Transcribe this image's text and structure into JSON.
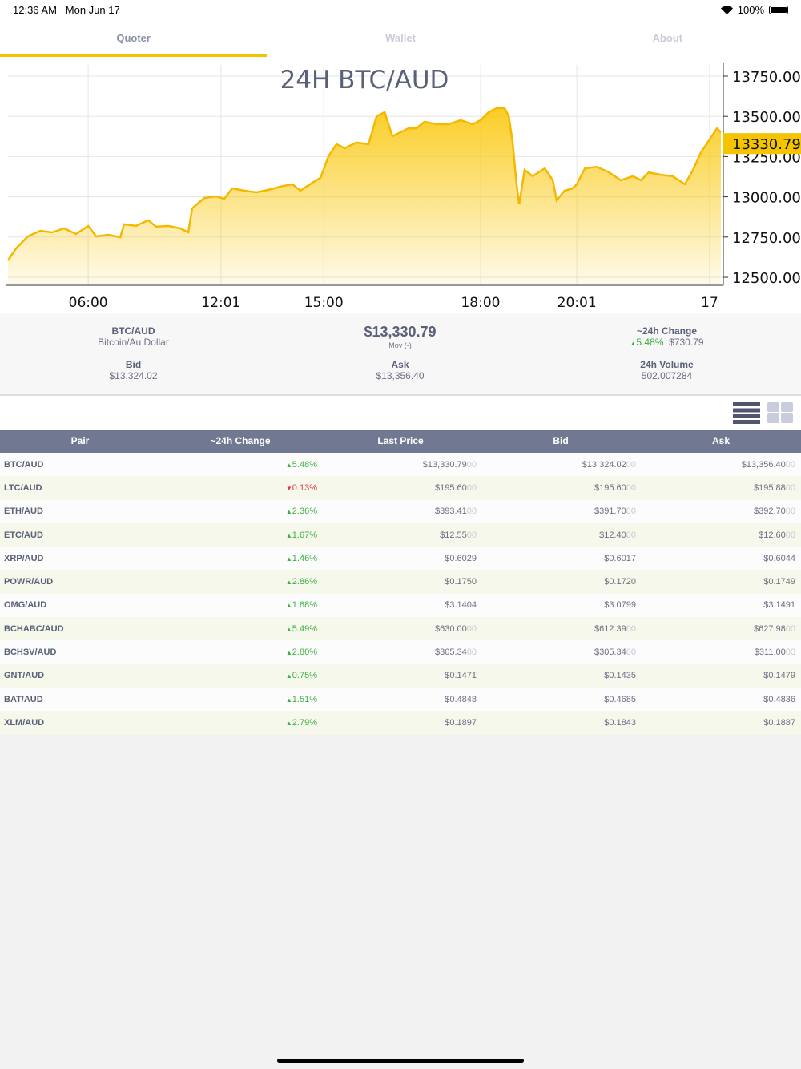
{
  "status": {
    "time": "12:36 AM",
    "date": "Mon Jun 17",
    "battery": "100%"
  },
  "tabs": [
    {
      "label": "Quoter",
      "active": true
    },
    {
      "label": "Wallet",
      "active": false
    },
    {
      "label": "About",
      "active": false
    }
  ],
  "chart_data": {
    "type": "area",
    "title": "24H BTC/AUD",
    "color": "#f5c400",
    "ylim": [
      12450,
      13800
    ],
    "yticks": [
      12500,
      12750,
      13000,
      13250,
      13500,
      13750
    ],
    "ytick_labels": [
      "12500.00",
      "12750.00",
      "13000.00",
      "13250.00",
      "13500.00",
      "13750.00"
    ],
    "xlim": [
      0,
      24
    ],
    "xticks": [
      {
        "x": 2.7,
        "label": "06:00"
      },
      {
        "x": 7.17,
        "label": "12:01"
      },
      {
        "x": 10.63,
        "label": "15:00"
      },
      {
        "x": 15.91,
        "label": "18:00"
      },
      {
        "x": 19.15,
        "label": "20:01"
      },
      {
        "x": 23.62,
        "label": "17"
      }
    ],
    "current": {
      "value": 13330.79,
      "label": "13330.79"
    },
    "x": [
      0,
      0.27,
      0.67,
      1.08,
      1.48,
      1.89,
      2.29,
      2.7,
      2.97,
      3.37,
      3.78,
      3.91,
      4.31,
      4.72,
      4.99,
      5.39,
      5.8,
      6.07,
      6.2,
      6.61,
      7.01,
      7.28,
      7.55,
      7.96,
      8.36,
      8.76,
      9.17,
      9.57,
      9.84,
      10.25,
      10.52,
      10.79,
      11.06,
      11.33,
      11.73,
      12.14,
      12.41,
      12.68,
      12.94,
      13.21,
      13.48,
      13.75,
      14.02,
      14.43,
      14.83,
      15.24,
      15.64,
      15.91,
      16.18,
      16.45,
      16.72,
      16.86,
      16.99,
      17.12,
      17.21,
      17.39,
      17.66,
      18.07,
      18.34,
      18.47,
      18.74,
      19.01,
      19.15,
      19.42,
      19.82,
      20.23,
      20.63,
      21.04,
      21.31,
      21.57,
      21.98,
      22.38,
      22.79,
      23.06,
      23.33,
      23.6,
      23.87,
      24
    ],
    "values": [
      12604,
      12679,
      12754,
      12789,
      12779,
      12804,
      12769,
      12819,
      12754,
      12764,
      12749,
      12829,
      12819,
      12854,
      12814,
      12819,
      12804,
      12779,
      12928,
      12993,
      13003,
      12988,
      13053,
      13038,
      13028,
      13043,
      13063,
      13078,
      13038,
      13088,
      13118,
      13252,
      13327,
      13302,
      13337,
      13327,
      13501,
      13526,
      13377,
      13401,
      13426,
      13426,
      13466,
      13451,
      13451,
      13476,
      13451,
      13476,
      13526,
      13551,
      13551,
      13501,
      13337,
      13078,
      12953,
      13167,
      13128,
      13177,
      13103,
      12978,
      13038,
      13053,
      13078,
      13177,
      13187,
      13152,
      13103,
      13128,
      13103,
      13152,
      13137,
      13128,
      13078,
      13167,
      13277,
      13351,
      13426,
      13401
    ]
  },
  "info": {
    "pair": "BTC/AUD",
    "pair_name": "Bitcoin/Au Dollar",
    "price": "$13,330.79",
    "mov": "Mov (-)",
    "change_label": "~24h Change",
    "change_pct": "5.48%",
    "change_abs": "$730.79",
    "bid_label": "Bid",
    "bid": "$13,324.02",
    "ask_label": "Ask",
    "ask": "$13,356.40",
    "volume_label": "24h Volume",
    "volume": "502.007284"
  },
  "table": {
    "headers": [
      "Pair",
      "~24h Change",
      "Last Price",
      "Bid",
      "Ask"
    ],
    "rows": [
      {
        "pair": "BTC/AUD",
        "change": "5.48%",
        "dir": "up",
        "last": "$13,330.79",
        "last_pad": "00",
        "bid": "$13,324.02",
        "bid_pad": "00",
        "ask": "$13,356.40",
        "ask_pad": "00"
      },
      {
        "pair": "LTC/AUD",
        "change": "0.13%",
        "dir": "down",
        "last": "$195.60",
        "last_pad": "00",
        "bid": "$195.60",
        "bid_pad": "00",
        "ask": "$195.88",
        "ask_pad": "00"
      },
      {
        "pair": "ETH/AUD",
        "change": "2.36%",
        "dir": "up",
        "last": "$393.41",
        "last_pad": "00",
        "bid": "$391.70",
        "bid_pad": "00",
        "ask": "$392.70",
        "ask_pad": "00"
      },
      {
        "pair": "ETC/AUD",
        "change": "1.67%",
        "dir": "up",
        "last": "$12.55",
        "last_pad": "00",
        "bid": "$12.40",
        "bid_pad": "00",
        "ask": "$12.60",
        "ask_pad": "00"
      },
      {
        "pair": "XRP/AUD",
        "change": "1.46%",
        "dir": "up",
        "last": "$0.6029",
        "last_pad": "",
        "bid": "$0.6017",
        "bid_pad": "",
        "ask": "$0.6044",
        "ask_pad": ""
      },
      {
        "pair": "POWR/AUD",
        "change": "2.86%",
        "dir": "up",
        "last": "$0.1750",
        "last_pad": "",
        "bid": "$0.1720",
        "bid_pad": "",
        "ask": "$0.1749",
        "ask_pad": ""
      },
      {
        "pair": "OMG/AUD",
        "change": "1.88%",
        "dir": "up",
        "last": "$3.1404",
        "last_pad": "",
        "bid": "$3.0799",
        "bid_pad": "",
        "ask": "$3.1491",
        "ask_pad": ""
      },
      {
        "pair": "BCHABC/AUD",
        "change": "5.49%",
        "dir": "up",
        "last": "$630.00",
        "last_pad": "00",
        "bid": "$612.39",
        "bid_pad": "00",
        "ask": "$627.98",
        "ask_pad": "00"
      },
      {
        "pair": "BCHSV/AUD",
        "change": "2.80%",
        "dir": "up",
        "last": "$305.34",
        "last_pad": "00",
        "bid": "$305.34",
        "bid_pad": "00",
        "ask": "$311.00",
        "ask_pad": "00"
      },
      {
        "pair": "GNT/AUD",
        "change": "0.75%",
        "dir": "up",
        "last": "$0.1471",
        "last_pad": "",
        "bid": "$0.1435",
        "bid_pad": "",
        "ask": "$0.1479",
        "ask_pad": ""
      },
      {
        "pair": "BAT/AUD",
        "change": "1.51%",
        "dir": "up",
        "last": "$0.4848",
        "last_pad": "",
        "bid": "$0.4685",
        "bid_pad": "",
        "ask": "$0.4836",
        "ask_pad": ""
      },
      {
        "pair": "XLM/AUD",
        "change": "2.79%",
        "dir": "up",
        "last": "$0.1897",
        "last_pad": "",
        "bid": "$0.1843",
        "bid_pad": "",
        "ask": "$0.1887",
        "ask_pad": ""
      }
    ]
  }
}
